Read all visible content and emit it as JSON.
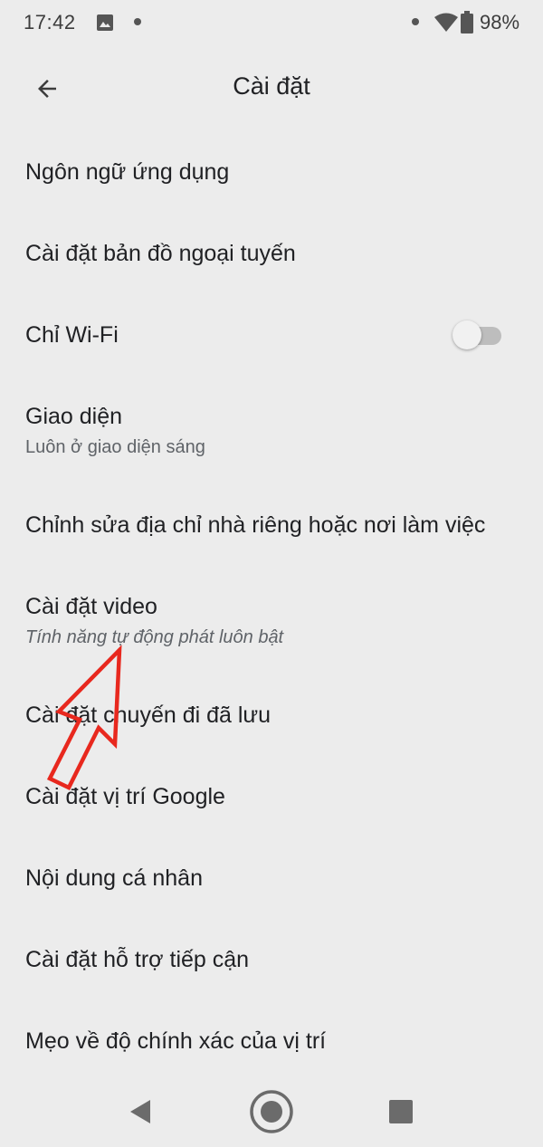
{
  "status_bar": {
    "time": "17:42",
    "battery": "98%"
  },
  "header": {
    "title": "Cài đặt",
    "back_icon": "arrow-back-icon"
  },
  "settings": [
    {
      "title": "Ngôn ngữ ứng dụng"
    },
    {
      "title": "Cài đặt bản đồ ngoại tuyến"
    },
    {
      "title": "Chỉ Wi-Fi",
      "toggle": false
    },
    {
      "title": "Giao diện",
      "subtitle": "Luôn ở giao diện sáng"
    },
    {
      "title": "Chỉnh sửa địa chỉ nhà riêng hoặc nơi làm việc"
    },
    {
      "title": "Cài đặt video",
      "subtitle": "Tính năng tự động phát luôn bật"
    },
    {
      "title": "Cài đặt chuyến đi đã lưu"
    },
    {
      "title": "Cài đặt vị trí Google"
    },
    {
      "title": "Nội dung cá nhân"
    },
    {
      "title": "Cài đặt hỗ trợ tiếp cận"
    },
    {
      "title": "Mẹo về độ chính xác của vị trí"
    }
  ],
  "annotation": {
    "color": "#e8281e",
    "icon": "red-arrow-annotation"
  },
  "nav_bar": {
    "icons": [
      "back-triangle-icon",
      "home-circle-icon",
      "recents-square-icon"
    ]
  }
}
